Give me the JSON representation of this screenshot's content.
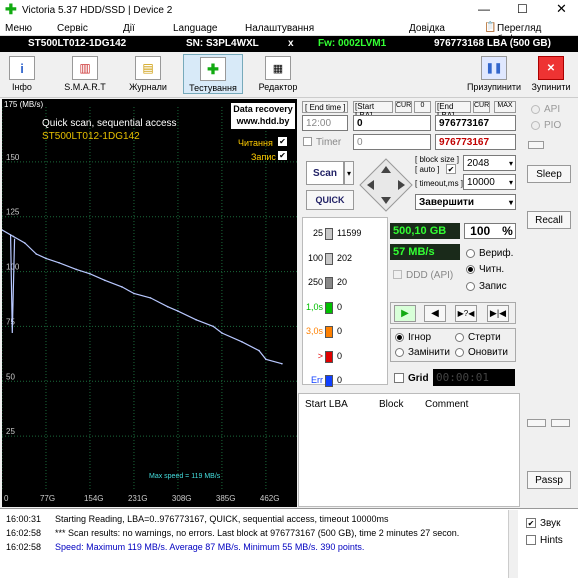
{
  "title": "Victoria 5.37 HDD/SSD | Device 2",
  "menu": [
    "Меню",
    "Сервіс",
    "Дії",
    "Language",
    "Налаштування",
    "Довідка"
  ],
  "clipboard": "Перегляд буфера",
  "info": {
    "model": "ST500LT012-1DG142",
    "sn": "SN: S3PL4WXL",
    "fw": "Fw: 0002LVM1",
    "lba": "976773168 LBA (500 GB)"
  },
  "tools": [
    "Інфо",
    "S.M.A.R.T",
    "Журнали",
    "Тестування",
    "Редактор"
  ],
  "right_tools": [
    "Призупинити",
    "Зупинити"
  ],
  "chart": {
    "ymax": "175 (MB/s)",
    "title": "Quick scan, sequential access",
    "model": "ST500LT012-1DG142",
    "dr1": "Data recovery",
    "dr2": "www.hdd.by",
    "read": "Читання",
    "write": "Запис",
    "max": "Max speed = 119 MB/s",
    "yticks": [
      "150",
      "125",
      "100",
      "75",
      "50",
      "25"
    ],
    "xticks": [
      "0",
      "77G",
      "154G",
      "231G",
      "308G",
      "385G",
      "462G"
    ]
  },
  "chart_data": {
    "type": "line",
    "title": "Quick scan, sequential access",
    "ylim": [
      0,
      175
    ],
    "x": [
      0,
      20,
      40,
      60,
      77,
      100,
      130,
      154,
      180,
      210,
      231,
      260,
      290,
      308,
      340,
      370,
      385,
      420,
      450,
      462,
      490
    ],
    "series": [
      {
        "name": "Читання",
        "values": [
          119,
          116,
          113,
          108,
          106,
          104,
          101,
          99,
          96,
          93,
          90,
          88,
          84,
          82,
          78,
          75,
          72,
          68,
          64,
          60,
          58
        ]
      }
    ]
  },
  "ctrl": {
    "end_time": "[ End time ]",
    "start_lba": "[Start LBA]",
    "cur": "CUR",
    "end_lba": "[End LBA]",
    "max": "MAX",
    "time": "12:00",
    "start_val": "0",
    "end_val": "976773167",
    "end_val2": "976773167",
    "timer": "Timer",
    "timer_val": "0",
    "scan": "Scan",
    "quick": "QUICK",
    "block_size": "[ block size ]",
    "auto": "[ auto ]",
    "timeout": "[ timeout,ms ]",
    "bs_val": "2048",
    "to_val": "10000",
    "finish": "Завершити"
  },
  "stats": [
    {
      "label": "25",
      "val": "11599",
      "color": "#c8c8c8"
    },
    {
      "label": "100",
      "val": "202",
      "color": "#c8c8c8"
    },
    {
      "label": "250",
      "val": "20",
      "color": "#888"
    },
    {
      "label": "1,0s",
      "val": "0",
      "color": "#00c000"
    },
    {
      "label": "3,0s",
      "val": "0",
      "color": "#ff8000"
    },
    {
      "label": ">",
      "val": "0",
      "color": "#e00000"
    },
    {
      "label": "Err",
      "val": "0",
      "color": "#1040ff"
    }
  ],
  "progress": {
    "size": "500,10 GB",
    "pct": "100",
    "pct_unit": "%",
    "speed": "57 MB/s",
    "ddd": "DDD (API)",
    "verify": "Вериф.",
    "read": "Читн.",
    "write": "Запис"
  },
  "actions": {
    "ignore": "Ігнор",
    "erase": "Стерти",
    "remap": "Замінити",
    "refresh": "Оновити",
    "grid": "Grid",
    "clock": "00:00:01"
  },
  "table": {
    "c1": "Start LBA",
    "c2": "Block",
    "c3": "Comment"
  },
  "side": {
    "api": "API",
    "pio": "PIO",
    "sleep": "Sleep",
    "recall": "Recall",
    "passp": "Passp"
  },
  "log": [
    {
      "t": "16:00:31",
      "m": "Starting Reading, LBA=0..976773167, QUICK, sequential access, timeout 10000ms",
      "c": "#000"
    },
    {
      "t": "16:02:58",
      "m": "*** Scan results: no warnings, no errors. Last block at 976773167 (500 GB), time 2 minutes 27 secon.",
      "c": "#000"
    },
    {
      "t": "16:02:58",
      "m": "Speed: Maximum 119 MB/s. Average 87 MB/s. Minimum 55 MB/s. 390 points.",
      "c": "#0000c0"
    }
  ],
  "sound": "Звук",
  "hints": "Hints"
}
